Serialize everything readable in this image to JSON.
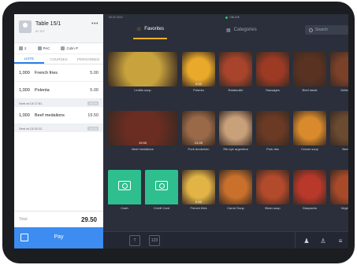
{
  "colors": {
    "accent": "#3d8cf1",
    "favorite": "#f5b12b",
    "online": "#28c76f",
    "payment_tile": "#2fbf8f"
  },
  "order": {
    "title": "Table 15/1",
    "subtitle": "ID 107",
    "more_icon": "more-dots-icon",
    "meta": {
      "guests": "2",
      "category": "PAC",
      "waiter": "Colin P"
    },
    "tabs": [
      "LISTE",
      "COURSES",
      "PERSONNES"
    ],
    "lines_block1": [
      {
        "qty": "1,000",
        "name": "French fries",
        "price": "5.00"
      },
      {
        "qty": "1,000",
        "name": "Polenta",
        "price": "5.00"
      }
    ],
    "sent1": {
      "label": "Sent at 13:17:51",
      "badge": "10:20"
    },
    "lines_block2": [
      {
        "qty": "1,000",
        "name": "Beef medalions",
        "price": "19.50"
      }
    ],
    "sent2": {
      "label": "Sent at 13:32:12",
      "badge": "10:20"
    },
    "total_label": "Total",
    "total_amount": "29.50",
    "pay_label": "Pay"
  },
  "status": {
    "date": "05.02.2019",
    "online": "ONLINE"
  },
  "nav": {
    "favorites": "Favorites",
    "categories": "Categories",
    "search_placeholder": "Search"
  },
  "products": [
    {
      "name": "Lentils soup",
      "price": "",
      "color": "#c8a23c"
    },
    {
      "name": "Polenta",
      "price": "5.00",
      "color": "#e9a92a"
    },
    {
      "name": "Ratatouille",
      "price": "",
      "color": "#a8442c"
    },
    {
      "name": "Sausages",
      "price": "",
      "color": "#9c3a24"
    },
    {
      "name": "Beef steak",
      "price": "",
      "color": "#5a3222"
    },
    {
      "name": "Grilled m",
      "price": "",
      "color": "#7a4028"
    },
    {
      "name": "Beef medalions",
      "price": "19.50",
      "color": "#6b2c22"
    },
    {
      "name": "Pork tenderloin",
      "price": "21.00",
      "color": "#9a6a48"
    },
    {
      "name": "Rib eye argentina",
      "price": "",
      "color": "#c8a07a"
    },
    {
      "name": "Pork ribs",
      "price": "",
      "color": "#6a3a24"
    },
    {
      "name": "Cream soup",
      "price": "",
      "color": "#d88a2c"
    },
    {
      "name": "Beef s",
      "price": "",
      "color": "#6a4a30"
    },
    {
      "name": "Cash",
      "price": "",
      "color": "#2fbf8f"
    },
    {
      "name": "Credit Card",
      "price": "",
      "color": "#2fbf8f"
    },
    {
      "name": "French fries",
      "price": "5.00",
      "color": "#e2b446"
    },
    {
      "name": "Carrot Soup",
      "price": "",
      "color": "#c8702c"
    },
    {
      "name": "Bean soup",
      "price": "",
      "color": "#b24a2c"
    },
    {
      "name": "Gaspacho",
      "price": "",
      "color": "#b8382a"
    },
    {
      "name": "Vegetab",
      "price": "",
      "color": "#a84a2a"
    }
  ],
  "bottom": {
    "button_a": "T",
    "button_b": "123"
  }
}
